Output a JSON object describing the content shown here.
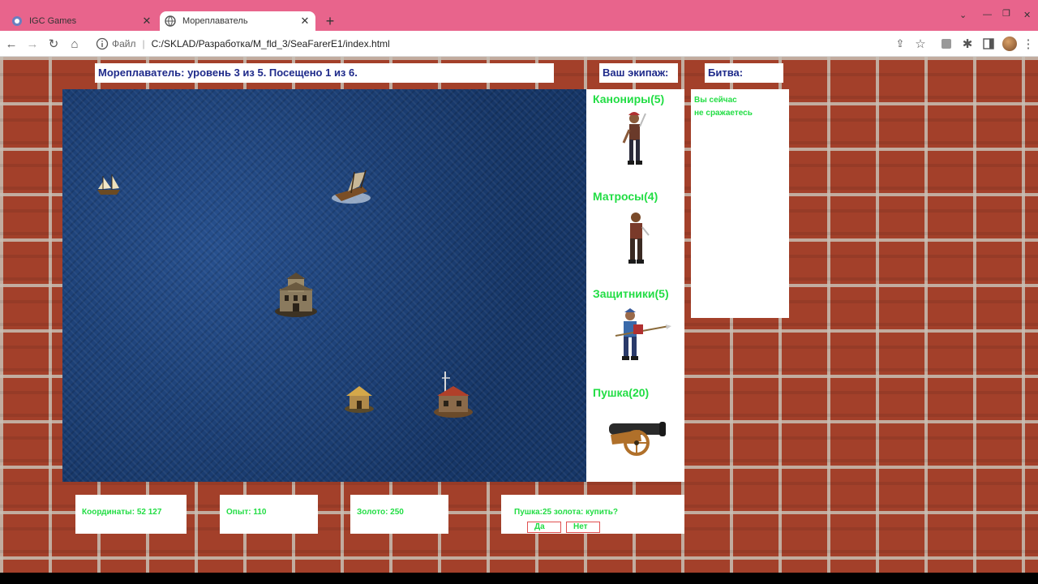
{
  "browser": {
    "tabs": [
      {
        "title": "IGC Games",
        "active": false
      },
      {
        "title": "Мореплаватель",
        "active": true
      }
    ],
    "address": {
      "scheme": "Файл",
      "path": "C:/SKLAD/Разработка/M_fld_3/SeaFarerE1/index.html"
    }
  },
  "header": {
    "title": "Мореплаватель: уровень 3 из 5. Посещено 1 из 6.",
    "crew_title": "Ваш экипаж:",
    "battle_title": "Битва:"
  },
  "crew": [
    {
      "label": "Канониры(5)",
      "icon": "pirate-gunner-icon"
    },
    {
      "label": "Матросы(4)",
      "icon": "sailor-icon"
    },
    {
      "label": "Защитники(5)",
      "icon": "pikeman-icon"
    },
    {
      "label": "Пушка(20)",
      "icon": "cannon-icon"
    }
  ],
  "battle": {
    "line1": "Вы сейчас",
    "line2": "не сражаетесь"
  },
  "stats": {
    "coords": "Координаты: 52 127",
    "exp": "Опыт: 110",
    "gold": "Золото: 250"
  },
  "offer": {
    "text": "Пушка:25 золота: купить?",
    "yes": "Да",
    "no": "Нет"
  },
  "colors": {
    "title": "#1e2a8a",
    "label": "#22dd44",
    "button_border": "#e05050",
    "sea": "#1a3a6b"
  }
}
